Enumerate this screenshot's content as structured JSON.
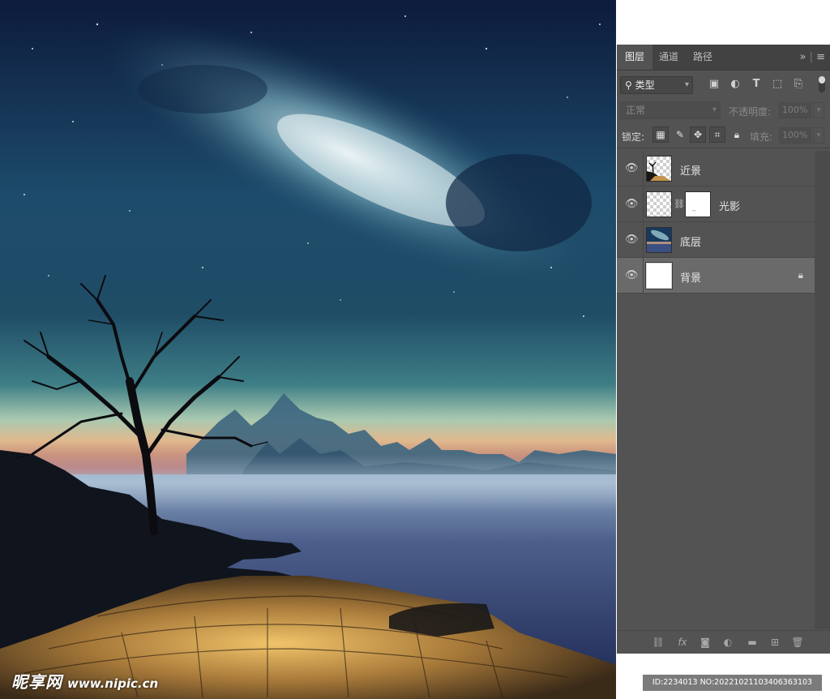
{
  "canvas": {
    "description_icon": "night-landscape-artwork",
    "watermark": {
      "logo": "昵享网",
      "url": "www.nipic.cn"
    }
  },
  "panel": {
    "tabs": [
      {
        "label": "图层",
        "active": true
      },
      {
        "label": "通道",
        "active": false
      },
      {
        "label": "路径",
        "active": false
      }
    ],
    "menu_icons": [
      "collapse-icon",
      "panel-menu-icon"
    ],
    "filter": {
      "kind_label": "类型",
      "icons": [
        "image-filter-icon",
        "adjustment-filter-icon",
        "type-filter-icon",
        "shape-filter-icon",
        "smart-object-filter-icon"
      ]
    },
    "blend": {
      "mode": "正常",
      "opacity_label": "不透明度:",
      "opacity_value": "100%"
    },
    "lock": {
      "label": "锁定:",
      "icons": [
        "lock-transparent-icon",
        "lock-paint-icon",
        "lock-position-icon",
        "lock-artboard-icon",
        "lock-all-icon"
      ],
      "fill_label": "填充:",
      "fill_value": "100%"
    },
    "layers": [
      {
        "name": "近景",
        "visible": true,
        "thumb": "foreground-thumb",
        "has_mask": false,
        "locked": false,
        "selected": false
      },
      {
        "name": "光影",
        "visible": true,
        "thumb": "transparent-thumb",
        "has_mask": true,
        "locked": false,
        "selected": false
      },
      {
        "name": "底层",
        "visible": true,
        "thumb": "sky-thumb",
        "has_mask": false,
        "locked": false,
        "selected": false
      },
      {
        "name": "背景",
        "visible": true,
        "thumb": "white-thumb",
        "has_mask": false,
        "locked": true,
        "selected": true
      }
    ],
    "footer_icons": [
      "link-layers-icon",
      "fx-icon",
      "add-mask-icon",
      "adjustment-layer-icon",
      "new-group-icon",
      "new-layer-icon",
      "delete-layer-icon"
    ]
  },
  "id_strip": "ID:2234013 NO:20221021103406363103",
  "colors": {
    "panel_bg": "#535353",
    "tab_bg": "#424242",
    "selected_layer": "#6a6a6a"
  }
}
